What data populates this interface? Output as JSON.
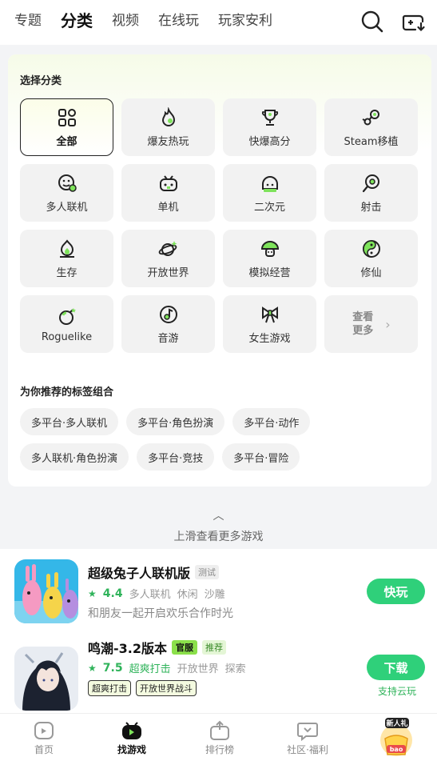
{
  "top_nav": {
    "tabs": [
      {
        "label": "专题"
      },
      {
        "label": "分类",
        "active": true
      },
      {
        "label": "视频"
      },
      {
        "label": "在线玩"
      },
      {
        "label": "玩家安利"
      }
    ],
    "icons": [
      "search-icon",
      "gamepad-download-icon"
    ]
  },
  "categories": {
    "title": "选择分类",
    "items": [
      {
        "label": "全部",
        "icon": "grid-icon",
        "selected": true
      },
      {
        "label": "爆友热玩",
        "icon": "fire-icon"
      },
      {
        "label": "快爆高分",
        "icon": "trophy-icon"
      },
      {
        "label": "Steam移植",
        "icon": "steam-icon"
      },
      {
        "label": "多人联机",
        "icon": "multiplayer-icon"
      },
      {
        "label": "单机",
        "icon": "gamepad-icon"
      },
      {
        "label": "二次元",
        "icon": "anime-icon"
      },
      {
        "label": "射击",
        "icon": "target-icon"
      },
      {
        "label": "生存",
        "icon": "campfire-icon"
      },
      {
        "label": "开放世界",
        "icon": "planet-icon"
      },
      {
        "label": "模拟经营",
        "icon": "mushroom-icon"
      },
      {
        "label": "修仙",
        "icon": "yinyang-icon"
      },
      {
        "label": "Roguelike",
        "icon": "bomb-icon"
      },
      {
        "label": "音游",
        "icon": "music-icon"
      },
      {
        "label": "女生游戏",
        "icon": "bow-icon"
      }
    ],
    "more": {
      "line1": "查看",
      "line2": "更多"
    }
  },
  "recommended_tags": {
    "title": "为你推荐的标签组合",
    "items": [
      "多平台·多人联机",
      "多平台·角色扮演",
      "多平台·动作",
      "多人联机·角色扮演",
      "多平台·竞技",
      "多平台·冒险"
    ]
  },
  "hint": {
    "text": "上滑查看更多游戏"
  },
  "games": [
    {
      "name": "超级兔子人联机版",
      "badge": "测试",
      "score": "4.4",
      "tags": [
        "多人联机",
        "休闲",
        "沙雕"
      ],
      "desc": "和朋友一起开启欢乐合作时光",
      "button": "快玩"
    },
    {
      "name": "鸣潮-3.2版本",
      "badge_server": "官服",
      "badge_rec": "推荐",
      "score": "7.5",
      "highlight_tag": "超爽打击",
      "tags": [
        "开放世界",
        "探索"
      ],
      "pills": [
        "超爽打击",
        "开放世界战斗"
      ],
      "button": "下载",
      "cloud": "支持云玩"
    }
  ],
  "bottom_nav": [
    {
      "label": "首页",
      "icon": "home-icon"
    },
    {
      "label": "找游戏",
      "icon": "find-game-icon",
      "active": true
    },
    {
      "label": "排行榜",
      "icon": "ranking-icon"
    },
    {
      "label": "社区·福利",
      "icon": "community-icon"
    }
  ],
  "gift": {
    "badge": "新人礼",
    "text": "bao"
  },
  "colors": {
    "accent": "#2fd07a",
    "highlight": "#7ee35b",
    "score": "#2fb35a"
  }
}
